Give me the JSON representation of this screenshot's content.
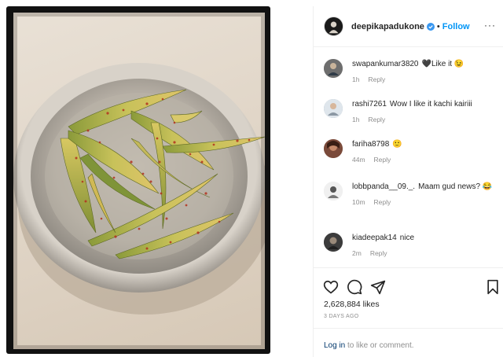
{
  "post": {
    "author": "deepikapadukone",
    "verified": true,
    "separator": "•",
    "follow_label": "Follow",
    "more_label": "···"
  },
  "comments": [
    {
      "username": "swapankumar3820",
      "text": "🖤Like it 😉",
      "time": "1h",
      "reply_label": "Reply",
      "avatar_color": "#6e6e6e"
    },
    {
      "username": "rashi7261",
      "text": "Wow I like it kachi kairiii",
      "time": "1h",
      "reply_label": "Reply",
      "avatar_color": "#a7b4c2"
    },
    {
      "username": "fariha8798",
      "text": "🙂",
      "time": "44m",
      "reply_label": "Reply",
      "avatar_color": "#7a4a3a"
    },
    {
      "username": "lobbpanda__09._.",
      "text": "Maam gud news? 😂",
      "time": "10m",
      "reply_label": "Reply",
      "avatar_color": "#e4e4e4"
    },
    {
      "username": "kiadeepak14",
      "text": "nice",
      "time": "2m",
      "reply_label": "Reply",
      "avatar_color": "#3c3c3c"
    }
  ],
  "actions": {
    "icons": [
      "heart-icon",
      "comment-icon",
      "share-icon",
      "bookmark-icon"
    ],
    "likes": "2,628,884 likes",
    "date": "3 DAYS AGO"
  },
  "login": {
    "link_label": "Log in",
    "suffix": " to like or comment."
  },
  "colors": {
    "link_blue": "#0095f6",
    "meta_gray": "#8e8e8e",
    "login_blue": "#00376b"
  }
}
